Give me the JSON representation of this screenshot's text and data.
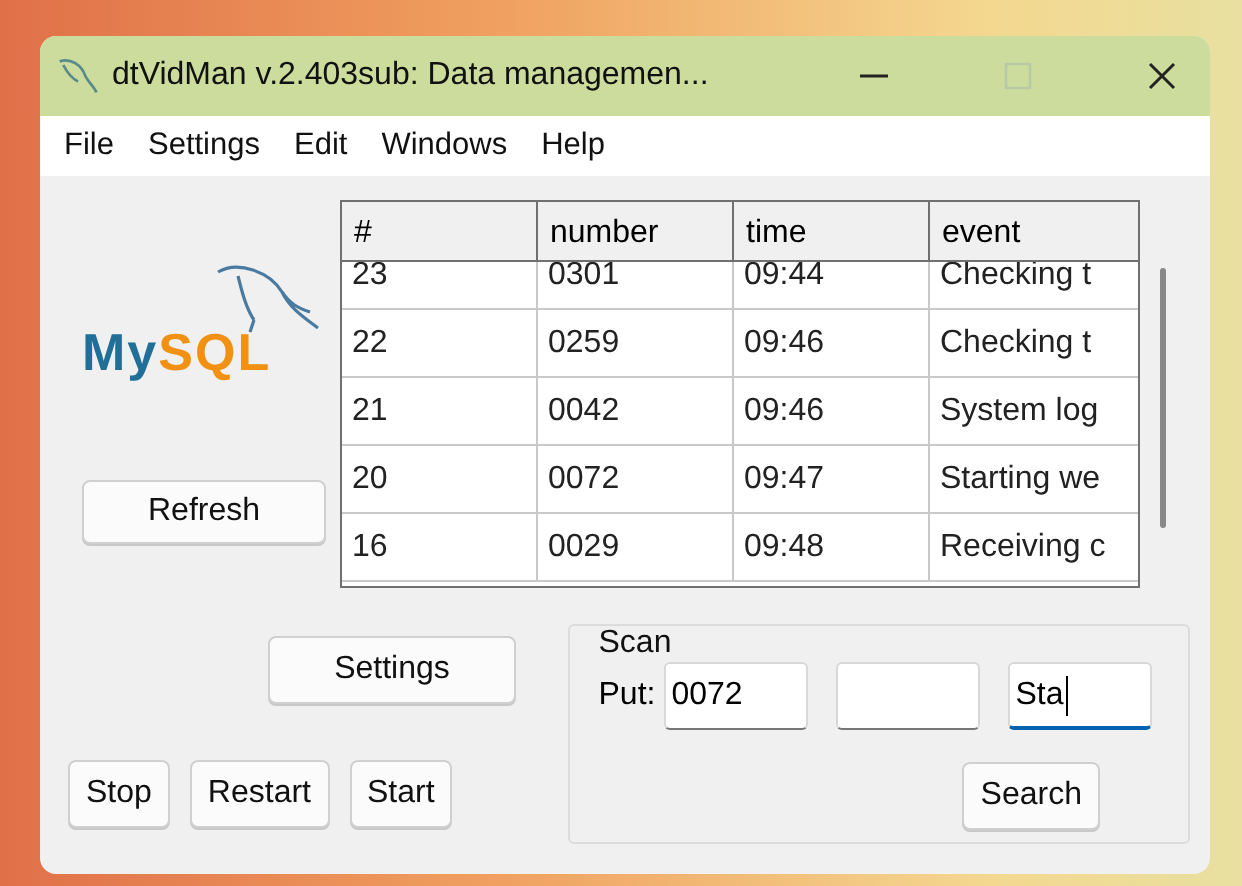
{
  "window": {
    "title": "dtVidMan v.2.403sub: Data managemen..."
  },
  "menu": [
    "File",
    "Settings",
    "Edit",
    "Windows",
    "Help"
  ],
  "logo": {
    "text": "MySQL"
  },
  "refresh_button": "Refresh",
  "table": {
    "columns": [
      "#",
      "number",
      "time",
      "event"
    ],
    "rows": [
      [
        "23",
        "0301",
        "09:44",
        "Checking t"
      ],
      [
        "22",
        "0259",
        "09:46",
        "Checking t"
      ],
      [
        "21",
        "0042",
        "09:46",
        "System log"
      ],
      [
        "20",
        "0072",
        "09:47",
        "Starting we"
      ],
      [
        "16",
        "0029",
        "09:48",
        "Receiving c"
      ]
    ]
  },
  "settings_button": "Settings",
  "control_buttons": [
    "Stop",
    "Restart",
    "Start"
  ],
  "scan": {
    "title": "Scan",
    "put_label": "Put:",
    "fields": [
      {
        "value": "0072",
        "focused": false
      },
      {
        "focused": false
      },
      {
        "value": "Sta",
        "focused": true
      }
    ],
    "search_button": "Search"
  }
}
